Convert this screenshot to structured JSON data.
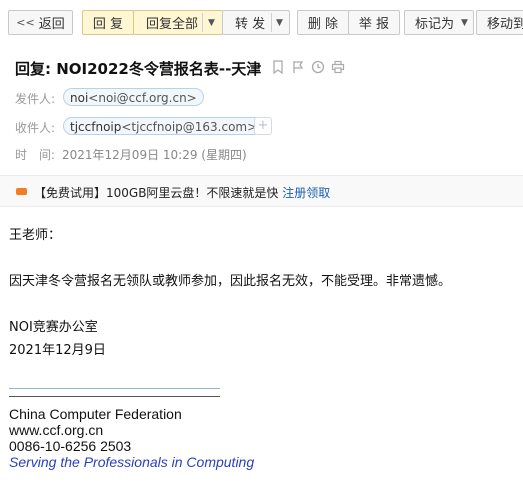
{
  "toolbar": {
    "back": "返回",
    "reply": "回 复",
    "reply_all": "回复全部",
    "forward": "转 发",
    "delete": "删 除",
    "report": "举 报",
    "mark_as": "标记为",
    "move_to": "移动到"
  },
  "email": {
    "subject": "回复: NOI2022冬令营报名表--天津",
    "from_label": "发件人:",
    "from_name": "noi",
    "from_addr": "<noi@ccf.org.cn>",
    "to_label": "收件人:",
    "to_name": "tjccfnoip",
    "to_addr": "<tjccfnoip@163.com>",
    "time_label": "时　间:",
    "time_value": "2021年12月09日 10:29 (星期四)"
  },
  "ad": {
    "text": "【免费试用】100GB阿里云盘！不限速就是快",
    "link": "注册领取"
  },
  "body": {
    "greeting": "王老师：",
    "content": "因天津冬令营报名无领队或教师参加，因此报名无效，不能受理。非常遗憾。",
    "sender": "NOI竞赛办公室",
    "date": "2021年12月9日"
  },
  "signature": {
    "org": "China Computer Federation",
    "website": "www.ccf.org.cn",
    "phone": "0086-10-6256 2503",
    "slogan": "Serving the Professionals in Computing"
  },
  "colors": {
    "accent_yellow": "#fff7d4",
    "link_blue": "#1a5fb4",
    "slogan_blue": "#2a3fbf",
    "ad_orange": "#f37d23"
  }
}
